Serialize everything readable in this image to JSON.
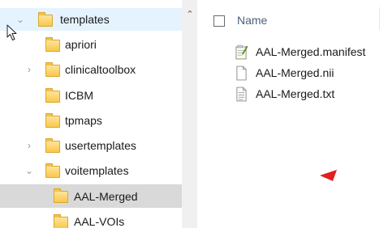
{
  "tree": {
    "items": [
      {
        "label": "templates",
        "expander": "expanded",
        "state": "hover"
      },
      {
        "label": "apriori",
        "expander": "none",
        "state": "normal"
      },
      {
        "label": "clinicaltoolbox",
        "expander": "collapsed",
        "state": "normal"
      },
      {
        "label": "ICBM",
        "expander": "none",
        "state": "normal"
      },
      {
        "label": "tpmaps",
        "expander": "none",
        "state": "normal"
      },
      {
        "label": "usertemplates",
        "expander": "collapsed",
        "state": "normal"
      },
      {
        "label": "voitemplates",
        "expander": "expanded",
        "state": "normal"
      },
      {
        "label": "AAL-Merged",
        "expander": "none",
        "state": "selected"
      },
      {
        "label": "AAL-VOIs",
        "expander": "none",
        "state": "normal"
      }
    ]
  },
  "list": {
    "header": {
      "name_label": "Name"
    },
    "files": [
      {
        "name": "AAL-Merged.manifest",
        "icon": "manifest-file-icon"
      },
      {
        "name": "AAL-Merged.nii",
        "icon": "blank-file-icon"
      },
      {
        "name": "AAL-Merged.txt",
        "icon": "text-file-icon"
      }
    ]
  },
  "colors": {
    "hover": "#e5f3ff",
    "selected": "#d9d9d9",
    "folder": "#f9c84b",
    "header_text": "#4c607a",
    "annotation_arrow": "#e0201e"
  }
}
